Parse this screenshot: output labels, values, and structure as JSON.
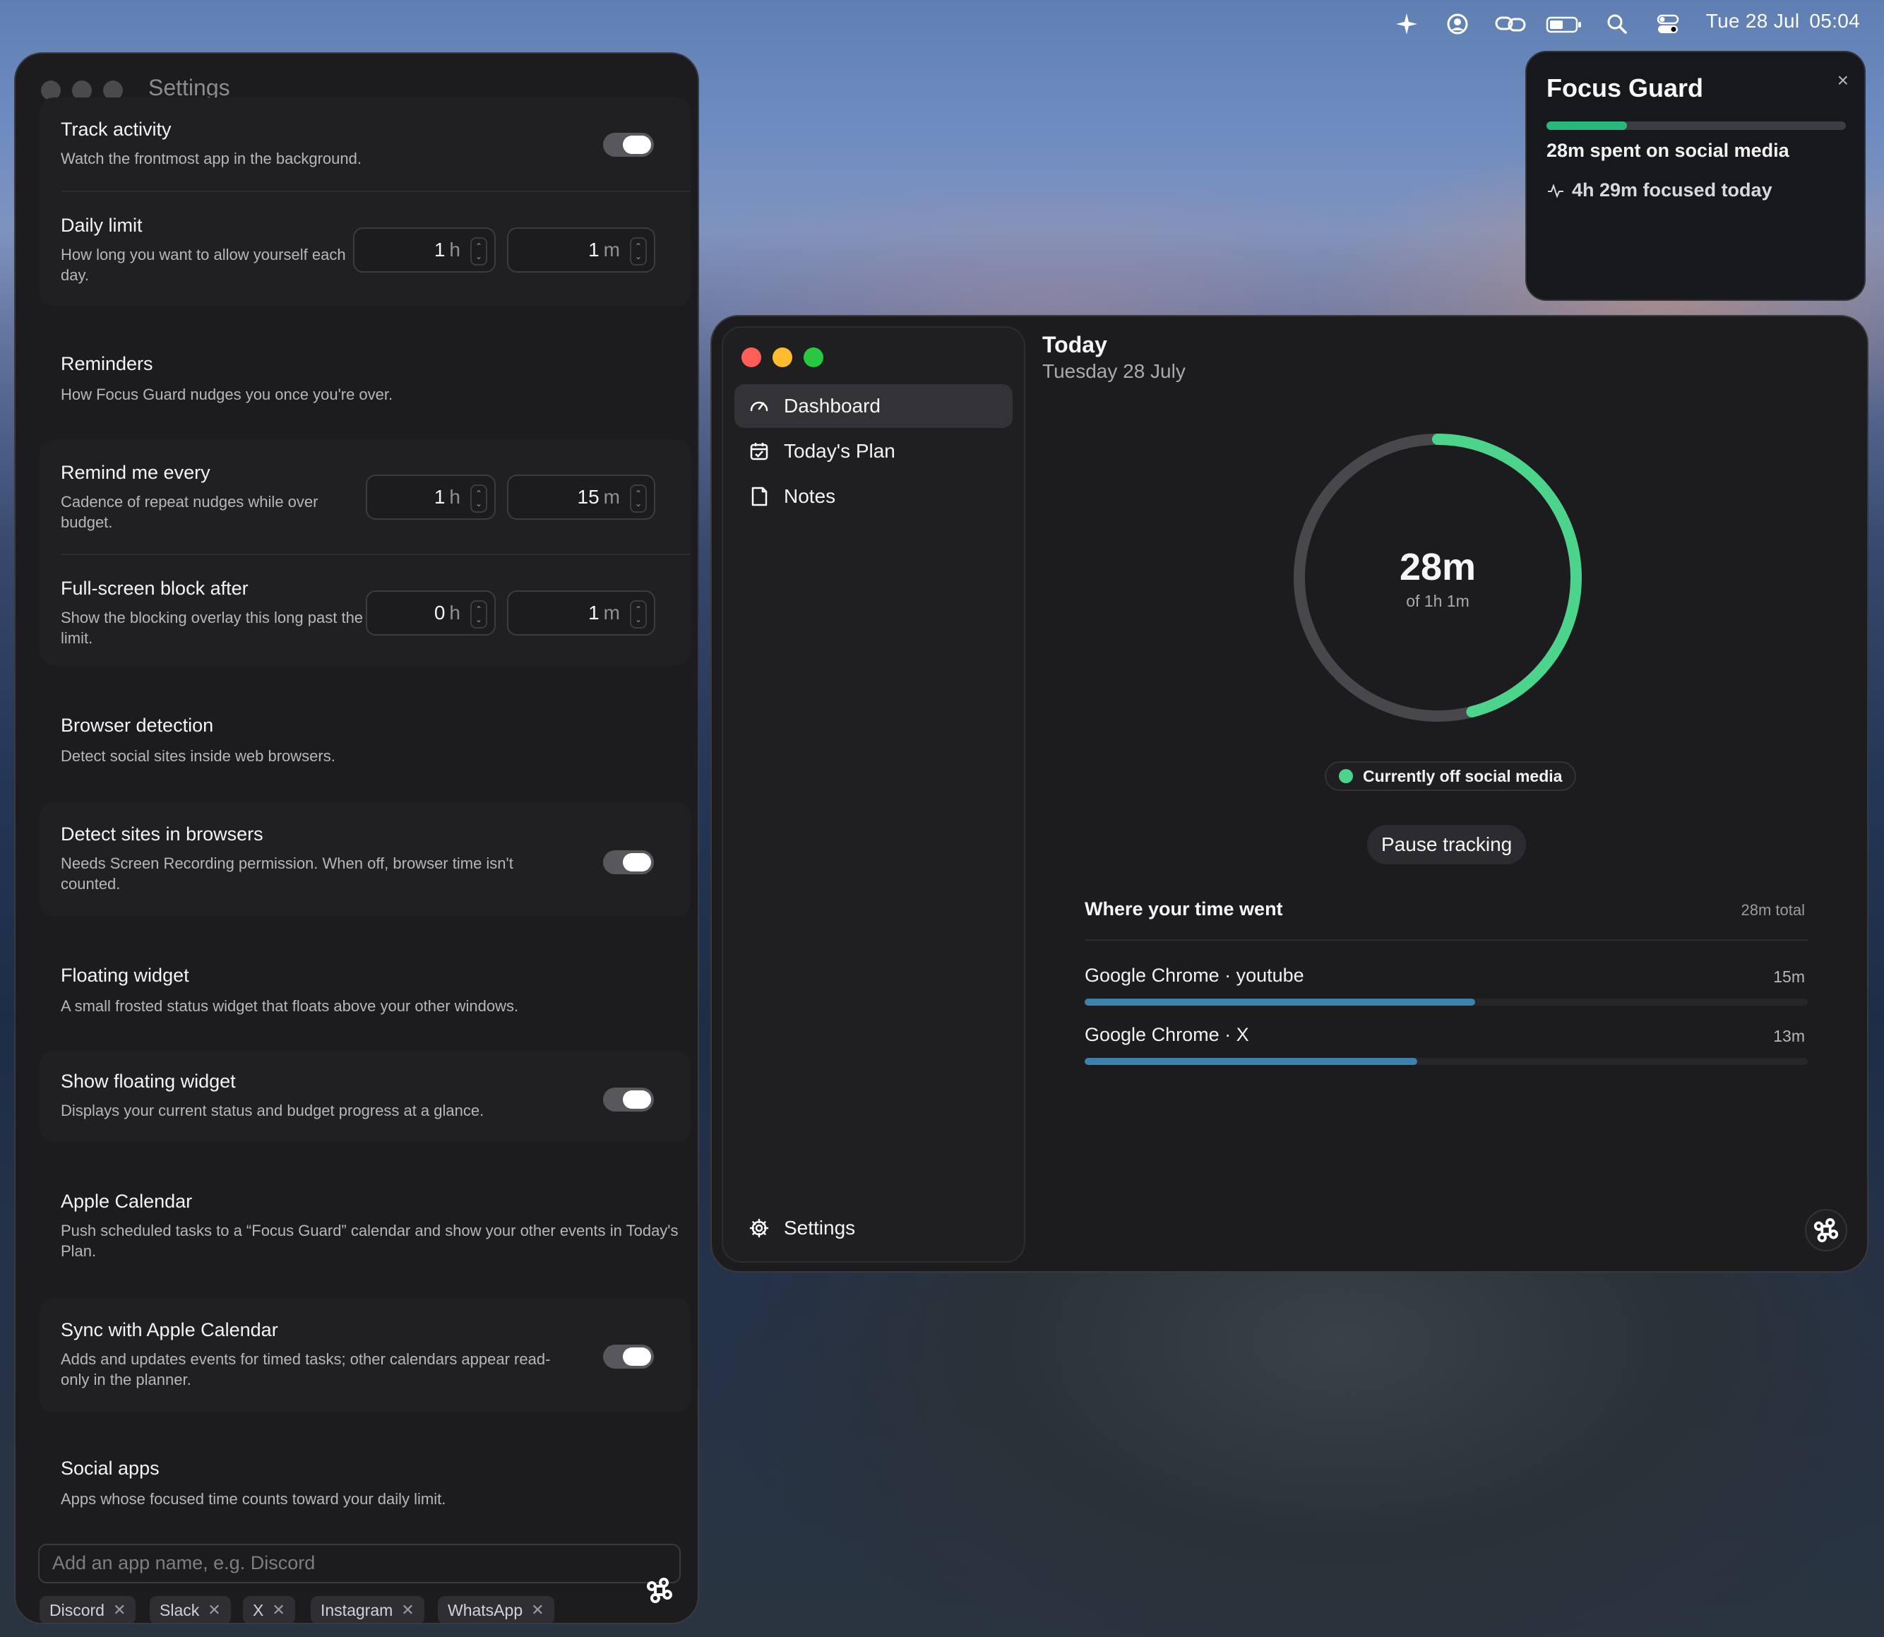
{
  "menubar": {
    "icons": [
      "sparkle-icon",
      "account-icon",
      "link-icon",
      "battery-icon",
      "search-icon",
      "control-center-icon"
    ],
    "date": "Tue 28 Jul",
    "time": "05:04"
  },
  "settings": {
    "title": "Settings",
    "track_activity": {
      "title": "Track activity",
      "desc": "Watch the frontmost app in the background.",
      "enabled": true
    },
    "daily_limit": {
      "title": "Daily limit",
      "desc": "How long you want to allow yourself each day.",
      "hours": "1",
      "hours_unit": "h",
      "minutes": "1",
      "minutes_unit": "m"
    },
    "reminders": {
      "title": "Reminders",
      "desc": "How Focus Guard nudges you once you're over."
    },
    "remind_every": {
      "title": "Remind me every",
      "desc": "Cadence of repeat nudges while over budget.",
      "hours": "1",
      "hours_unit": "h",
      "minutes": "15",
      "minutes_unit": "m"
    },
    "block_after": {
      "title": "Full-screen block after",
      "desc": "Show the blocking overlay this long past the limit.",
      "hours": "0",
      "hours_unit": "h",
      "minutes": "1",
      "minutes_unit": "m"
    },
    "browser_detection": {
      "title": "Browser detection",
      "desc": "Detect social sites inside web browsers."
    },
    "detect_sites": {
      "title": "Detect sites in browsers",
      "desc": "Needs Screen Recording permission. When off, browser time isn't counted.",
      "enabled": true
    },
    "floating_widget": {
      "title": "Floating widget",
      "desc": "A small frosted status widget that floats above your other windows."
    },
    "show_widget": {
      "title": "Show floating widget",
      "desc": "Displays your current status and budget progress at a glance.",
      "enabled": true
    },
    "apple_calendar": {
      "title": "Apple Calendar",
      "desc": "Push scheduled tasks to a “Focus Guard” calendar and show your other events in Today's Plan."
    },
    "sync_calendar": {
      "title": "Sync with Apple Calendar",
      "desc": "Adds and updates events for timed tasks; other calendars appear read-only in the planner.",
      "enabled": true
    },
    "social_apps": {
      "title": "Social apps",
      "desc": "Apps whose focused time counts toward your daily limit."
    },
    "app_input_placeholder": "Add an app name, e.g. Discord",
    "apps": [
      "Discord",
      "Slack",
      "X",
      "Instagram",
      "WhatsApp"
    ],
    "remove_glyph": "✕"
  },
  "main": {
    "nav": [
      {
        "label": "Dashboard",
        "icon": "gauge-icon",
        "active": true
      },
      {
        "label": "Today's Plan",
        "icon": "calendar-icon",
        "active": false
      },
      {
        "label": "Notes",
        "icon": "note-icon",
        "active": false
      }
    ],
    "settings_label": "Settings",
    "today_title": "Today",
    "today_date": "Tuesday 28 July",
    "ring": {
      "value": "28m",
      "of": "of 1h 1m",
      "progress": 0.46,
      "color": "#4cd48c",
      "track_color": "#48484c"
    },
    "status": "Currently off social media",
    "pause_label": "Pause tracking",
    "breakdown": {
      "title": "Where your time went",
      "total": "28m total",
      "items": [
        {
          "name": "Google Chrome · youtube",
          "time": "15m",
          "fraction": 0.54
        },
        {
          "name": "Google Chrome · X",
          "time": "13m",
          "fraction": 0.46
        }
      ]
    }
  },
  "widget": {
    "title": "Focus Guard",
    "close": "×",
    "progress": 0.27,
    "line1": "28m spent on social media",
    "line2": "4h 29m focused today",
    "accent": "#28b87a"
  }
}
